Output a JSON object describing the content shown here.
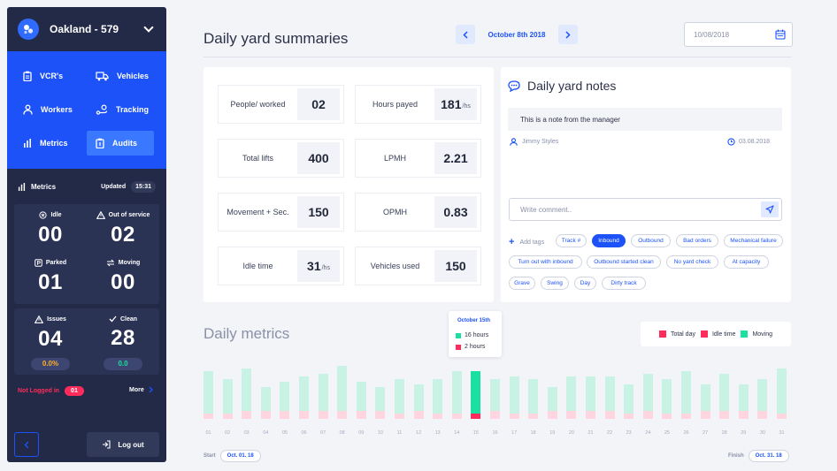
{
  "sidebar": {
    "location": "Oakland - 579",
    "nav": [
      {
        "label": "VCR's",
        "icon": "clipboard-icon"
      },
      {
        "label": "Vehicles",
        "icon": "truck-icon"
      },
      {
        "label": "Workers",
        "icon": "worker-icon"
      },
      {
        "label": "Tracking",
        "icon": "route-icon"
      },
      {
        "label": "Metrics",
        "icon": "bar-chart-icon"
      },
      {
        "label": "Audits",
        "icon": "audit-icon"
      }
    ],
    "metrics_label": "Metrics",
    "updated_label": "Updated",
    "updated_time": "15:31",
    "stats": {
      "idle": {
        "label": "Idle",
        "value": "00"
      },
      "out_of_service": {
        "label": "Out of service",
        "value": "02"
      },
      "parked": {
        "label": "Parked",
        "value": "01"
      },
      "moving": {
        "label": "Moving",
        "value": "00"
      },
      "issues": {
        "label": "Issues",
        "value": "04",
        "pct": "0.0%"
      },
      "clean": {
        "label": "Clean",
        "value": "28",
        "pct": "0.0"
      }
    },
    "not_logged_label": "Not Logged in",
    "not_logged_count": "01",
    "more_label": "More",
    "logout_label": "Log out"
  },
  "header": {
    "title": "Daily yard summaries",
    "current_date": "October 8th 2018",
    "date_input_value": "10/08/2018"
  },
  "summary": {
    "people_worked": {
      "label": "People/ worked",
      "value": "02"
    },
    "hours_payed": {
      "label": "Hours payed",
      "value": "181",
      "unit": "/hs"
    },
    "total_lifts": {
      "label": "Total lifts",
      "value": "400"
    },
    "lpmh": {
      "label": "LPMH",
      "value": "2.21"
    },
    "movement_sec": {
      "label": "Movement + Sec.",
      "value": "150"
    },
    "opmh": {
      "label": "OPMH",
      "value": "0.83"
    },
    "idle_time": {
      "label": "Idle time",
      "value": "31",
      "unit": "/hs"
    },
    "vehicles_used": {
      "label": "Vehicles used",
      "value": "150"
    }
  },
  "notes": {
    "title": "Daily yard notes",
    "note_text": "This is a note from the manager",
    "author": "Jimmy Styles",
    "date": "03.08.2018",
    "comment_placeholder": "Write comment..",
    "add_tags_label": "Add tags",
    "tags": [
      "Track #",
      "Inbound",
      "Outbound",
      "Bad orders",
      "Mechanical failure",
      "Turn out with inbound",
      "Outbound started clean",
      "No yard check",
      "At capacity",
      "Grave",
      "Swing",
      "Day",
      "Dirty track"
    ],
    "active_tag": "Inbound"
  },
  "metrics": {
    "title": "Daily metrics",
    "tooltip": {
      "date": "October 15th",
      "moving": "16 hours",
      "idle": "2 hours"
    },
    "legend": [
      "Total day",
      "Idle time",
      "Moving"
    ],
    "colors": {
      "total": "#c8f2e4",
      "idle": "#ffd6e0",
      "moving": "#19e0a0",
      "idle_strong": "#ff2b5a",
      "accent": "#1c52f8"
    },
    "start_label": "Start",
    "start_date": "Oct. 01. 18",
    "finish_label": "Finish",
    "finish_date": "Oct. 31. 18"
  },
  "chart_data": {
    "type": "bar",
    "categories": [
      "01",
      "02",
      "03",
      "04",
      "05",
      "06",
      "07",
      "08",
      "09",
      "10",
      "11",
      "12",
      "13",
      "14",
      "15",
      "16",
      "17",
      "18",
      "19",
      "20",
      "21",
      "22",
      "23",
      "24",
      "25",
      "26",
      "27",
      "28",
      "29",
      "30",
      "31"
    ],
    "series": [
      {
        "name": "Total day",
        "values": [
          18,
          15,
          19,
          12,
          14,
          16,
          17,
          20,
          14,
          12,
          15,
          13,
          15,
          18,
          18,
          15,
          16,
          15,
          12,
          16,
          16,
          16,
          13,
          17,
          15,
          18,
          13,
          17,
          13,
          15,
          19
        ]
      },
      {
        "name": "Idle time",
        "values": [
          2,
          2,
          3,
          3,
          3,
          3,
          3,
          3,
          3,
          3,
          2,
          3,
          2,
          2,
          2,
          3,
          2,
          2,
          3,
          3,
          3,
          3,
          2,
          3,
          2,
          2,
          3,
          3,
          3,
          3,
          2
        ]
      }
    ],
    "highlight_category": "15",
    "highlight": {
      "moving": 16,
      "idle": 2
    }
  }
}
